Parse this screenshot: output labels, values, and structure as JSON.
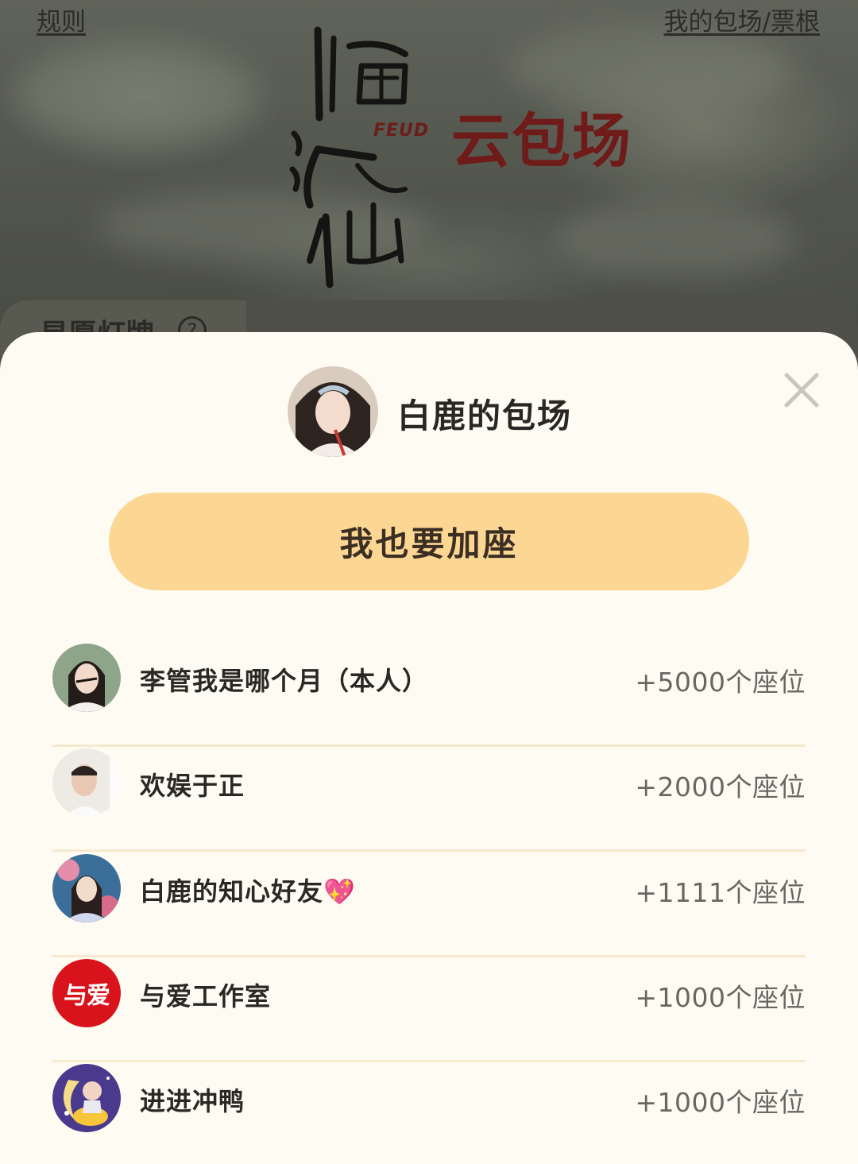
{
  "header": {
    "rules_link": "规则",
    "mine_link": "我的包场/票根",
    "feud": "FEUD",
    "cloud_title": "云包场"
  },
  "behind": {
    "section_label": "星愿灯牌",
    "help_glyph": "?"
  },
  "sheet": {
    "host_title": "白鹿的包场",
    "join_button": "我也要加座",
    "rows": [
      {
        "name": "李管我是哪个月（本人）",
        "seats": "+5000个座位"
      },
      {
        "name": "欢娱于正",
        "seats": "+2000个座位"
      },
      {
        "name": "白鹿的知心好友",
        "emoji": "💖",
        "seats": "+1111个座位"
      },
      {
        "name": "与爱工作室",
        "seats": "+1000个座位",
        "avatar_text": "与爱"
      },
      {
        "name": "进进冲鸭",
        "seats": "+1000个座位"
      }
    ]
  },
  "colors": {
    "sheet_bg": "#fefcf2",
    "button_bg": "#fcd693",
    "divider": "#f7e8cf",
    "brand_red": "#6e1b1a"
  }
}
